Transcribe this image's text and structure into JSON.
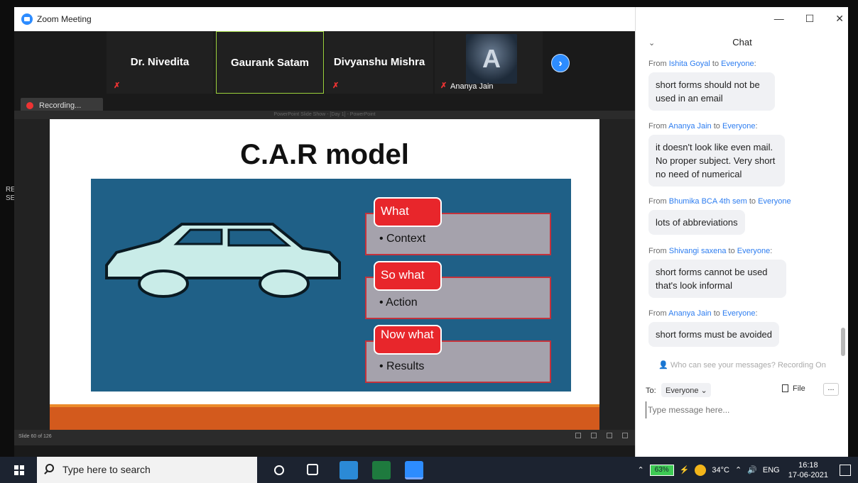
{
  "window": {
    "title": "Zoom Meeting"
  },
  "gallery": {
    "tiles": [
      {
        "name": "Dr. Nivedita"
      },
      {
        "name": "Gaurank Satam"
      },
      {
        "name": "Divyanshu Mishra"
      },
      {
        "name": "Ananya Jain"
      }
    ],
    "recording": "Recording..."
  },
  "share": {
    "ppt_title": "PowerPoint Slide Show - [Day 1] - PowerPoint",
    "slide_counter": "Slide 60 of 126",
    "slide": {
      "title": "C.A.R model",
      "rows": [
        {
          "tag": "What",
          "bullet": "Context"
        },
        {
          "tag": "So what",
          "bullet": "Action"
        },
        {
          "tag": "Now what",
          "bullet": "Results"
        }
      ]
    }
  },
  "edge_text": {
    "line1": "RE",
    "line2": "SE"
  },
  "chat": {
    "header": "Chat",
    "messages": [
      {
        "from": "Ishita Goyal",
        "to": "Everyone",
        "text": "short forms should not be used in an email"
      },
      {
        "from": "Ananya Jain",
        "to": "Everyone",
        "text": "it doesn't look like even mail. No proper subject. Very short no need of numerical"
      },
      {
        "from": "Bhumika BCA 4th sem",
        "to": "Everyone",
        "text": "lots of abbreviations"
      },
      {
        "from": "Shivangi saxena",
        "to": "Everyone",
        "text": "short forms cannot be used that's look informal"
      },
      {
        "from": "Ananya Jain",
        "to": "Everyone",
        "text": "short forms must be avoided"
      }
    ],
    "from_word": "From",
    "to_word": "to",
    "privacy": "Who can see your messages? Recording On",
    "to_label": "To:",
    "to_value": "Everyone",
    "file_label": "File",
    "more_label": "...",
    "input_placeholder": "Type message here..."
  },
  "taskbar": {
    "search_placeholder": "Type here to search",
    "battery": "63%",
    "temperature": "34°C",
    "language": "ENG",
    "time": "16:18",
    "date": "17-06-2021"
  }
}
